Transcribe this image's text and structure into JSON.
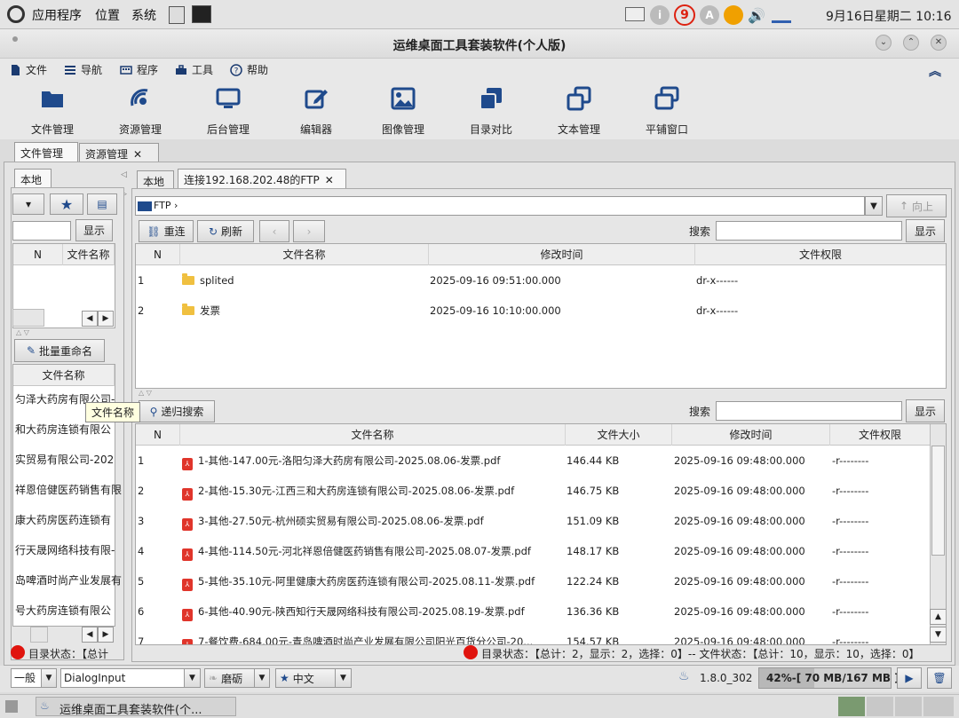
{
  "sysbar": {
    "menus": [
      "应用程序",
      "位置",
      "系统"
    ],
    "badge_count": "9",
    "datetime": "9月16日星期二 10:16"
  },
  "window": {
    "title": "运维桌面工具套装软件(个人版)"
  },
  "menubar": {
    "items": [
      {
        "label": "文件",
        "icon": "file-icon"
      },
      {
        "label": "导航",
        "icon": "list-icon"
      },
      {
        "label": "程序",
        "icon": "keyboard-icon"
      },
      {
        "label": "工具",
        "icon": "toolbox-icon"
      },
      {
        "label": "帮助",
        "icon": "help-icon"
      }
    ]
  },
  "toolbar": {
    "items": [
      {
        "label": "文件管理",
        "icon": "folder-open-icon"
      },
      {
        "label": "资源管理",
        "icon": "satellite-icon"
      },
      {
        "label": "后台管理",
        "icon": "monitor-icon"
      },
      {
        "label": "编辑器",
        "icon": "edit-icon"
      },
      {
        "label": "图像管理",
        "icon": "image-icon"
      },
      {
        "label": "目录对比",
        "icon": "clone-icon"
      },
      {
        "label": "文本管理",
        "icon": "copy-icon"
      },
      {
        "label": "平铺窗口",
        "icon": "windows-icon"
      }
    ]
  },
  "main_tabs": [
    "文件管理",
    "资源管理"
  ],
  "left_panel": {
    "tab": "本地",
    "show_btn": "显示",
    "col_n": "N",
    "col_name": "文件名称",
    "rename_btn": "批量重命名",
    "col_filename": "文件名称",
    "tooltip": "文件名称",
    "files": [
      "匀泽大药房有限公司-",
      "和大药房连锁有限公",
      "实贸易有限公司-202",
      "祥恩倍健医药销售有限",
      "康大药房医药连锁有",
      "行天晟网络科技有限-",
      "岛啤酒时尚产业发展有",
      "号大药房连锁有限公"
    ],
    "status": "目录状态：【总计"
  },
  "ftp_panel": {
    "tabs": [
      "本地",
      "连接192.168.202.48的FTP"
    ],
    "path": "FTP",
    "up_btn": "向上",
    "reconnect_btn": "重连",
    "refresh_btn": "刷新",
    "search_label": "搜索",
    "show_btn": "显示",
    "columns": [
      "N",
      "文件名称",
      "修改时间",
      "文件权限"
    ],
    "rows": [
      {
        "n": "1",
        "name": "splited",
        "time": "2025-09-16 09:51:00.000",
        "perm": "dr-x------"
      },
      {
        "n": "2",
        "name": "发票",
        "time": "2025-09-16 10:10:00.000",
        "perm": "dr-x------"
      }
    ]
  },
  "search_panel": {
    "recursive_btn": "递归搜索",
    "search_label": "搜索",
    "show_btn": "显示",
    "columns": [
      "N",
      "文件名称",
      "文件大小",
      "修改时间",
      "文件权限"
    ],
    "rows": [
      {
        "n": "1",
        "name": "1-其他-147.00元-洛阳匀泽大药房有限公司-2025.08.06-发票.pdf",
        "size": "146.44 KB",
        "time": "2025-09-16 09:48:00.000",
        "perm": "-r--------"
      },
      {
        "n": "2",
        "name": "2-其他-15.30元-江西三和大药房连锁有限公司-2025.08.06-发票.pdf",
        "size": "146.75 KB",
        "time": "2025-09-16 09:48:00.000",
        "perm": "-r--------"
      },
      {
        "n": "3",
        "name": "3-其他-27.50元-杭州硕实贸易有限公司-2025.08.06-发票.pdf",
        "size": "151.09 KB",
        "time": "2025-09-16 09:48:00.000",
        "perm": "-r--------"
      },
      {
        "n": "4",
        "name": "4-其他-114.50元-河北祥恩倍健医药销售有限公司-2025.08.07-发票.pdf",
        "size": "148.17 KB",
        "time": "2025-09-16 09:48:00.000",
        "perm": "-r--------"
      },
      {
        "n": "5",
        "name": "5-其他-35.10元-阿里健康大药房医药连锁有限公司-2025.08.11-发票.pdf",
        "size": "122.24 KB",
        "time": "2025-09-16 09:48:00.000",
        "perm": "-r--------"
      },
      {
        "n": "6",
        "name": "6-其他-40.90元-陕西知行天晟网络科技有限公司-2025.08.19-发票.pdf",
        "size": "136.36 KB",
        "time": "2025-09-16 09:48:00.000",
        "perm": "-r--------"
      },
      {
        "n": "7",
        "name": "7-餐饮费-684.00元-青岛啤酒时尚产业发展有限公司阳光百货分公司-20...",
        "size": "154.57 KB",
        "time": "2025-09-16 09:48:00.000",
        "perm": "-r--------"
      }
    ],
    "status": "目录状态：【总计：2，显示：2，选择：0】-- 文件状态：【总计：10，显示：10，选择：0】"
  },
  "statusbar": {
    "mode": "一般",
    "font": "DialogInput",
    "theme": "磨砺",
    "lang": "中文",
    "java": "1.8.0_302",
    "memory": "42%-[ 70 MB/167 MB ]"
  },
  "taskbar": {
    "window": "运维桌面工具套装软件(个..."
  }
}
